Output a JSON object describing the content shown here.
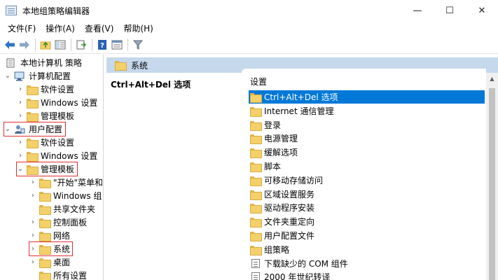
{
  "window": {
    "title": "本地组策略编辑器",
    "controls": {
      "minimize": "—",
      "maximize": "☐",
      "close": "✕"
    }
  },
  "menu": [
    "文件(F)",
    "操作(A)",
    "查看(V)",
    "帮助(H)"
  ],
  "toolbar": {
    "icons": [
      "back-arrow-icon",
      "forward-arrow-icon",
      "up-folder-icon",
      "show-tree-icon",
      "export-list-icon",
      "help-icon",
      "properties-icon",
      "filter-icon"
    ]
  },
  "tree": [
    {
      "label": "本地计算机 策略",
      "level": 0,
      "chevron": "",
      "icon": "policy-doc-icon"
    },
    {
      "label": "计算机配置",
      "level": 1,
      "chevron": "expanded",
      "icon": "computer-icon"
    },
    {
      "label": "软件设置",
      "level": 2,
      "chevron": "collapsed",
      "icon": "folder-icon"
    },
    {
      "label": "Windows 设置",
      "level": 2,
      "chevron": "collapsed",
      "icon": "folder-icon"
    },
    {
      "label": "管理模板",
      "level": 2,
      "chevron": "collapsed",
      "icon": "folder-icon"
    },
    {
      "label": "用户配置",
      "level": 1,
      "chevron": "expanded",
      "icon": "user-icon",
      "highlight": true
    },
    {
      "label": "软件设置",
      "level": 2,
      "chevron": "collapsed",
      "icon": "folder-icon"
    },
    {
      "label": "Windows 设置",
      "level": 2,
      "chevron": "collapsed",
      "icon": "folder-icon"
    },
    {
      "label": "管理模板",
      "level": 2,
      "chevron": "expanded",
      "icon": "folder-icon",
      "highlight": true
    },
    {
      "label": "\"开始\"菜单和",
      "level": 3,
      "chevron": "collapsed",
      "icon": "folder-icon"
    },
    {
      "label": "Windows 组",
      "level": 3,
      "chevron": "collapsed",
      "icon": "folder-icon"
    },
    {
      "label": "共享文件夹",
      "level": 3,
      "chevron": "",
      "icon": "folder-icon"
    },
    {
      "label": "控制面板",
      "level": 3,
      "chevron": "collapsed",
      "icon": "folder-icon"
    },
    {
      "label": "网络",
      "level": 3,
      "chevron": "collapsed",
      "icon": "folder-icon"
    },
    {
      "label": "系统",
      "level": 3,
      "chevron": "collapsed",
      "icon": "folder-icon",
      "highlight": true
    },
    {
      "label": "桌面",
      "level": 3,
      "chevron": "collapsed",
      "icon": "folder-icon"
    },
    {
      "label": "所有设置",
      "level": 3,
      "chevron": "",
      "icon": "folder-icon"
    }
  ],
  "right": {
    "header": "系统",
    "description_title": "Ctrl+Alt+Del 选项",
    "list_header": "设置",
    "items": [
      {
        "label": "Ctrl+Alt+Del 选项",
        "type": "folder",
        "selected": true
      },
      {
        "label": "Internet 通信管理",
        "type": "folder"
      },
      {
        "label": "登录",
        "type": "folder"
      },
      {
        "label": "电源管理",
        "type": "folder"
      },
      {
        "label": "缓解选项",
        "type": "folder"
      },
      {
        "label": "脚本",
        "type": "folder"
      },
      {
        "label": "可移动存储访问",
        "type": "folder"
      },
      {
        "label": "区域设置服务",
        "type": "folder"
      },
      {
        "label": "驱动程序安装",
        "type": "folder"
      },
      {
        "label": "文件夹重定向",
        "type": "folder"
      },
      {
        "label": "用户配置文件",
        "type": "folder"
      },
      {
        "label": "组策略",
        "type": "folder"
      },
      {
        "label": "下载缺少的 COM 组件",
        "type": "policy"
      },
      {
        "label": "2000 年世纪转译",
        "type": "policy"
      }
    ]
  },
  "colors": {
    "selection": "#0078d7",
    "header_bg": "#c5d8ec",
    "highlight_box": "#e03030"
  }
}
